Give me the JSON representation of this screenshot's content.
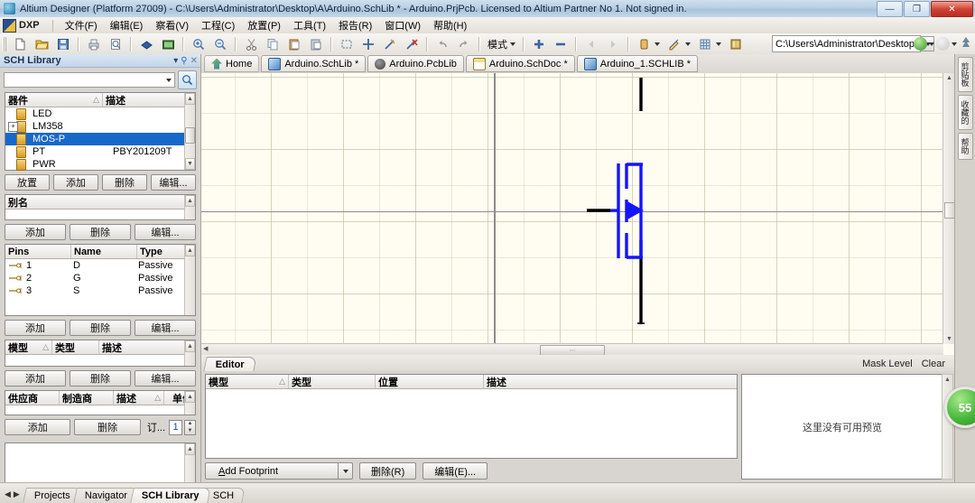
{
  "window": {
    "title": "Altium Designer (Platform 27009) - C:\\Users\\Administrator\\Desktop\\A\\Arduino.SchLib * - Arduino.PrjPcb. Licensed to Altium Partner No 1. Not signed in.",
    "minimize": "—",
    "maximize": "❐",
    "close": "✕"
  },
  "menu": {
    "dxp": "DXP",
    "items": [
      {
        "label": "文件(F)"
      },
      {
        "label": "编辑(E)"
      },
      {
        "label": "察看(V)"
      },
      {
        "label": "工程(C)"
      },
      {
        "label": "放置(P)"
      },
      {
        "label": "工具(T)"
      },
      {
        "label": "报告(R)"
      },
      {
        "label": "窗口(W)"
      },
      {
        "label": "帮助(H)"
      }
    ]
  },
  "toolbar": {
    "mode_label": "模式",
    "path_value": "C:\\Users\\Administrator\\Desktop",
    "icons": [
      "new-document-icon",
      "open-folder-icon",
      "save-icon",
      "print-icon",
      "print-preview-icon",
      "board-icon",
      "open-project-icon",
      "zoom-in-icon",
      "zoom-out-icon",
      "cut-icon",
      "copy-icon",
      "paste-icon",
      "paste-special-icon",
      "select-area-icon",
      "move-icon",
      "clear-filter-icon",
      "deselect-all-icon",
      "undo-icon",
      "redo-icon"
    ],
    "icons_right": [
      "add-icon",
      "remove-icon",
      "back-icon",
      "forward-icon",
      "component-icon",
      "draw-icon",
      "grid-icon",
      "library-icon"
    ]
  },
  "sch_library_panel": {
    "title": "SCH Library",
    "title_tools": [
      "chevron-down-icon",
      "pin-icon",
      "close-icon"
    ],
    "filter_placeholder": "",
    "components": {
      "headers": [
        "器件",
        "描述"
      ],
      "rows": [
        {
          "name": "LED",
          "desc": "",
          "expandable": false,
          "selected": false
        },
        {
          "name": "LM358",
          "desc": "",
          "expandable": true,
          "selected": false
        },
        {
          "name": "MOS-P",
          "desc": "",
          "expandable": false,
          "selected": true
        },
        {
          "name": "PT",
          "desc": "PBY201209T",
          "expandable": false,
          "selected": false
        },
        {
          "name": "PWR",
          "desc": "",
          "expandable": false,
          "selected": false
        }
      ],
      "buttons": [
        "放置",
        "添加",
        "删除",
        "编辑..."
      ]
    },
    "aliases": {
      "header": "别名",
      "buttons": [
        "添加",
        "删除",
        "编辑..."
      ]
    },
    "pins": {
      "headers": [
        "Pins",
        "Name",
        "Type"
      ],
      "rows": [
        {
          "pin": "1",
          "name": "D",
          "type": "Passive"
        },
        {
          "pin": "2",
          "name": "G",
          "type": "Passive"
        },
        {
          "pin": "3",
          "name": "S",
          "type": "Passive"
        }
      ],
      "buttons": [
        "添加",
        "删除",
        "编辑..."
      ]
    },
    "models": {
      "headers": [
        "模型",
        "类型",
        "描述"
      ],
      "rows": [],
      "buttons": [
        "添加",
        "删除",
        "编辑..."
      ]
    },
    "suppliers": {
      "headers": [
        "供应商",
        "制造商",
        "描述",
        "单价"
      ],
      "rows": [],
      "buttons": [
        "添加",
        "删除"
      ],
      "order_label": "订...",
      "order_value": "1"
    }
  },
  "doc_tabs": [
    {
      "label": "Home",
      "icon": "home-icon",
      "active": false
    },
    {
      "label": "Arduino.SchLib *",
      "icon": "schlib-icon",
      "active": true
    },
    {
      "label": "Arduino.PcbLib",
      "icon": "pcblib-icon",
      "active": false
    },
    {
      "label": "Arduino.SchDoc *",
      "icon": "schdoc-icon",
      "active": false
    },
    {
      "label": "Arduino_1.SCHLIB *",
      "icon": "schlib-icon",
      "active": false
    }
  ],
  "canvas": {
    "symbol": "mosfet-p-channel-symbol",
    "symbol_color": "#1414ff",
    "lead_color": "#000000",
    "background": "#fffdf2",
    "scroll_thumb_glyph": "⋯"
  },
  "editor_strip": {
    "tab": "Editor",
    "mask_level": "Mask Level",
    "clear": "Clear"
  },
  "bottom_pane": {
    "headers": [
      "模型",
      "类型",
      "位置",
      "描述"
    ],
    "rows": [],
    "buttons": [
      {
        "label": "Add Footprint",
        "underline": "A",
        "split": true
      },
      {
        "label": "删除(R)",
        "split": false
      },
      {
        "label": "编辑(E)...",
        "split": false
      }
    ],
    "preview_text": "这里没有可用预览"
  },
  "right_edge": {
    "tabs": [
      "剪贴板",
      "收藏的",
      "帮助"
    ]
  },
  "status_tabs": {
    "nav_prev": "◀",
    "nav_next": "▶",
    "tabs": [
      {
        "label": "Projects",
        "active": false
      },
      {
        "label": "Navigator",
        "active": false
      },
      {
        "label": "SCH Library",
        "active": true
      },
      {
        "label": "SCH",
        "active": false
      }
    ]
  },
  "badge": {
    "value": "55"
  },
  "colors": {
    "accent": "#1668c9",
    "symbol_blue": "#1414ff",
    "canvas_bg": "#fffdf2",
    "chrome": "#d8d5d0",
    "green_badge": "#48b93c"
  }
}
